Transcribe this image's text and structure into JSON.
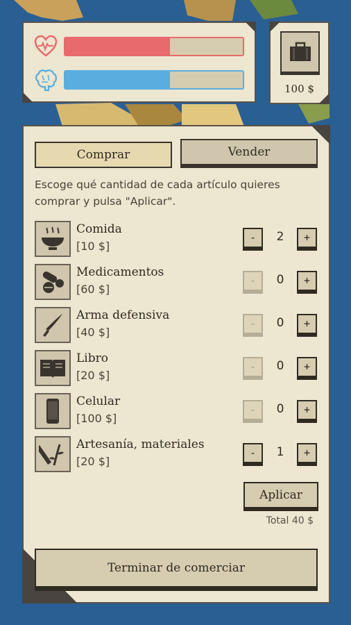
{
  "status": {
    "health_icon": "heart-icon",
    "health_level": 0.59,
    "health_color": "#e96a6c",
    "mind_icon": "brain-icon",
    "mind_level": 0.59,
    "mind_color": "#5aaedf"
  },
  "wallet": {
    "icon": "briefcase-icon",
    "money": "100 $"
  },
  "shop": {
    "tabs": {
      "buy": "Comprar",
      "sell": "Vender"
    },
    "instructions": "Escoge qué cantidad de cada artículo quieres comprar y pulsa \"Aplicar\".",
    "items": [
      {
        "name": "Comida",
        "price": "[10 $]",
        "qty": "2",
        "icon": "food-bowl-icon",
        "minus": "-",
        "plus": "+"
      },
      {
        "name": "Medicamentos",
        "price": "[60 $]",
        "qty": "0",
        "icon": "pills-icon",
        "minus": "-",
        "plus": "+"
      },
      {
        "name": "Arma defensiva",
        "price": "[40 $]",
        "qty": "0",
        "icon": "knife-icon",
        "minus": "-",
        "plus": "+"
      },
      {
        "name": "Libro",
        "price": "[20 $]",
        "qty": "0",
        "icon": "book-icon",
        "minus": "-",
        "plus": "+"
      },
      {
        "name": "Celular",
        "price": "[100 $]",
        "qty": "0",
        "icon": "phone-icon",
        "minus": "-",
        "plus": "+"
      },
      {
        "name": "Artesanía, materiales",
        "price": "[20 $]",
        "qty": "1",
        "icon": "crafts-icon",
        "minus": "-",
        "plus": "+"
      }
    ],
    "apply_label": "Aplicar",
    "total": "Total 40 $",
    "finish_label": "Terminar de comerciar"
  }
}
